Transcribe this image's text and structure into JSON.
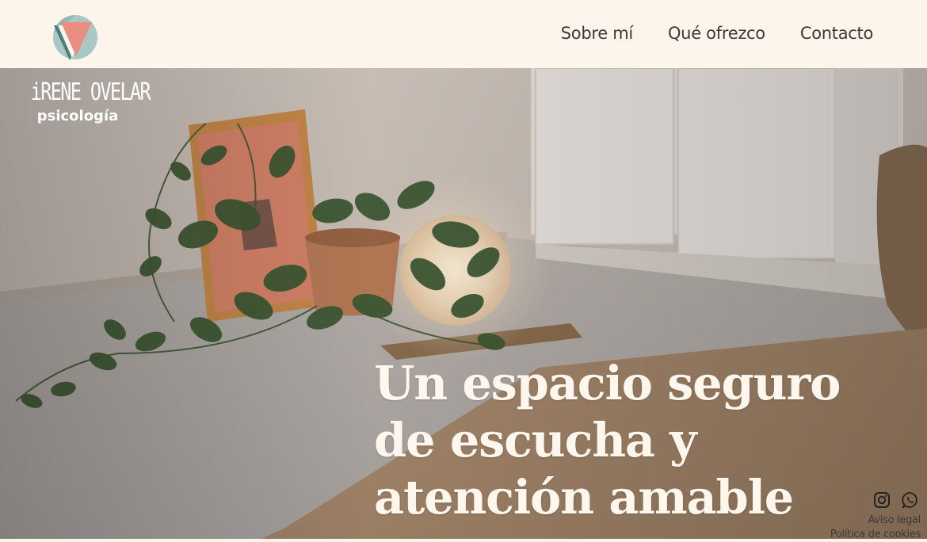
{
  "header": {
    "logo_icon": "triangle-in-circle-logo",
    "nav": [
      {
        "label": "Sobre mí"
      },
      {
        "label": "Qué ofrezco"
      },
      {
        "label": "Contacto"
      }
    ]
  },
  "brand": {
    "name": "iRENE OVELAR",
    "subtitle": "psicología"
  },
  "hero": {
    "headline": "Un espacio seguro de escucha y atención amable",
    "image": "room-with-plant-lamp-rug-photo"
  },
  "footer": {
    "social": [
      {
        "icon": "instagram-icon"
      },
      {
        "icon": "whatsapp-icon"
      }
    ],
    "links": [
      {
        "label": "Aviso legal"
      },
      {
        "label": "Política de cookies"
      }
    ]
  },
  "colors": {
    "header_bg": "#fdf4ec",
    "nav_text": "#3a3a3a",
    "headline_text": "#fff6ee",
    "logo_teal": "#8fb7b4",
    "logo_salmon": "#e98e80",
    "logo_dark": "#3f6a68"
  }
}
